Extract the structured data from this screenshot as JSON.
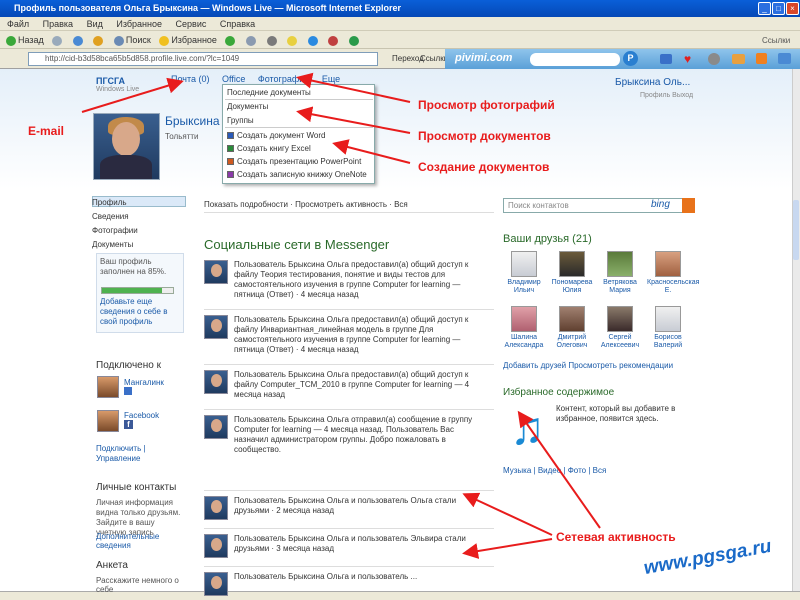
{
  "window": {
    "title": "Профиль пользователя Ольга Брыксина — Windows Live — Microsoft Internet Explorer"
  },
  "menu": [
    "Файл",
    "Правка",
    "Вид",
    "Избранное",
    "Сервис",
    "Справка"
  ],
  "toolbar": {
    "back": "Назад",
    "search": "Поиск",
    "favorites": "Избранное"
  },
  "address": {
    "url": "http://cid-b3d58bca65b5d858.profile.live.com/?lc=1049",
    "go": "Переход",
    "links": "Ссылки"
  },
  "pivimi": {
    "logo": "pivimi.com"
  },
  "browser_search": "Ссылки",
  "site": {
    "logo": "ПГСГА",
    "logo_sub": "Windows Live"
  },
  "nav": {
    "items": [
      "Почта (0)",
      "Office",
      "Фотографии",
      "Еще"
    ]
  },
  "user": {
    "name": "Брыксина Оль...",
    "sub": "Профиль  Выход"
  },
  "dropdown": {
    "items": [
      "Последние документы",
      "Документы",
      "Группы",
      "Создать документ Word",
      "Создать книгу Excel",
      "Создать презентацию PowerPoint",
      "Создать записную книжку OneNote"
    ]
  },
  "profile": {
    "name": "Брыксина",
    "line": "Тольятти"
  },
  "sidebar": {
    "items": [
      "Профиль",
      "Сведения",
      "Фотографии",
      "Документы"
    ],
    "progress_text": "Ваш профиль заполнен на 85%.",
    "progress": 0.85,
    "progress_link": "Добавьте еще сведения о себе в свой профиль",
    "connected_title": "Подключено к",
    "connected_items": [
      "Мангалинк",
      "Facebook"
    ],
    "connected_links": "Подключить | Управление",
    "contacts_title": "Личные контакты",
    "contacts_text": "Личная информация видна только друзьям. Зайдите в вашу учетную запись",
    "contacts_link": "Дополнительные сведения",
    "anketa_title": "Анкета",
    "anketa_text": "Расскажите немного о себе"
  },
  "filter": "Показать подробности  ·  Просмотреть активность  ·  Вся",
  "feed": {
    "title": "Социальные сети в Messenger",
    "items": [
      "Пользователь Брыксина Ольга предоставил(а) общий доступ к файлу Теория тестирования, понятие и виды тестов для самостоятельного изучения в группе Computer for learning — пятница (Ответ) · 4 месяца назад",
      "Пользователь Брыксина Ольга предоставил(а) общий доступ к файлу Инвариантная_линейная модель в группе Для самостоятельного изучения в группе Computer for learning — пятница (Ответ) · 4 месяца назад",
      "Пользователь Брыксина Ольга предоставил(а) общий доступ к файлу Computer_TCM_2010 в группе Computer for learning — 4 месяца назад",
      "Пользователь Брыксина Ольга отправил(а) сообщение в группу Computer for learning — 4 месяца назад. Пользователь Вас назначил администратором группы. Добро пожаловать в сообщество.",
      "Пользователь Брыксина Ольга и пользователь Ольга стали друзьями · 2 месяца назад",
      "Пользователь Брыксина Ольга и пользователь Эльвира стали друзьями · 3 месяца назад",
      "Пользователь Брыксина Ольга и пользователь ..."
    ]
  },
  "search": {
    "placeholder": "Поиск контактов",
    "brand": "bing"
  },
  "friends": {
    "title": "Ваши друзья (21)",
    "list": [
      {
        "name": "Владимир Ильич"
      },
      {
        "name": "Пономарева Юлия"
      },
      {
        "name": "Ветрякова Мария"
      },
      {
        "name": "Красносельская Е."
      },
      {
        "name": "Шалина Александра"
      },
      {
        "name": "Дмитрий Олегович"
      },
      {
        "name": "Сергей Алексеевич"
      },
      {
        "name": "Борисов Валерий"
      }
    ],
    "links": "Добавить друзей    Просмотреть рекомендации"
  },
  "favorites": {
    "title": "Избранное содержимое",
    "text": "Контент, который вы добавите в избранное, появится здесь.",
    "links": "Музыка | Видео | Фото | Вся"
  },
  "annotations": {
    "email": "E-mail",
    "photos": "Просмотр фотографий",
    "docs": "Просмотр документов",
    "create": "Создание документов",
    "network": "Сетевая активность"
  },
  "watermark": "www.pgsga.ru",
  "colors": {
    "annotation": "#e81c1c",
    "accent": "#1a5aa8",
    "title_green": "#2a6a2a"
  }
}
